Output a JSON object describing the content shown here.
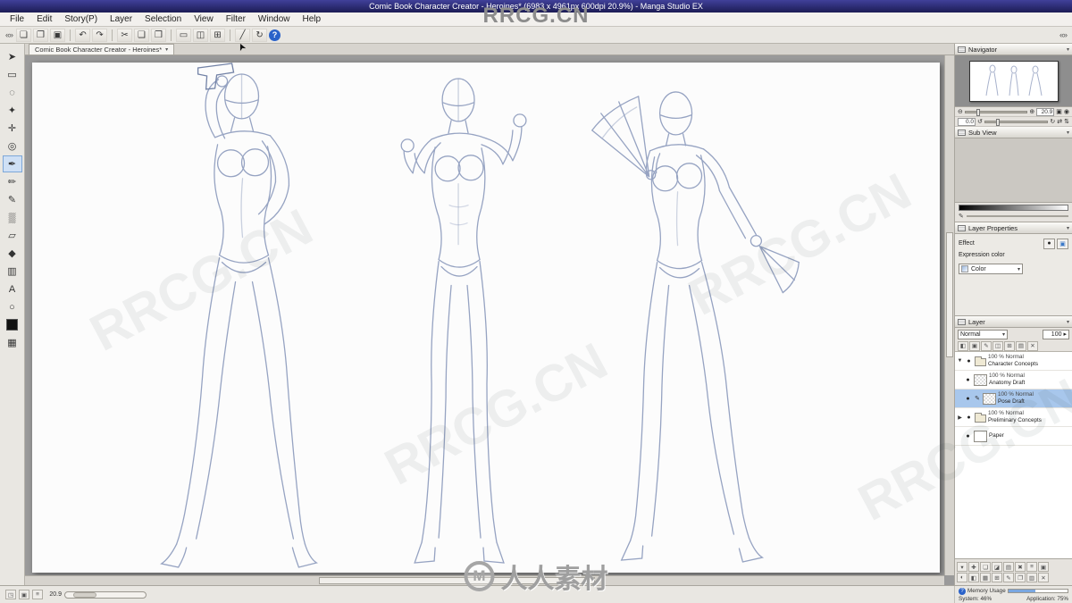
{
  "titlebar": {
    "title": "Comic Book Character Creator - Heroines* (6983 x 4961px 600dpi 20.9%) - Manga Studio EX"
  },
  "menubar": {
    "items": [
      "File",
      "Edit",
      "Story(P)",
      "Layer",
      "Selection",
      "View",
      "Filter",
      "Window",
      "Help"
    ]
  },
  "chrome": {
    "left": "«»",
    "right": "«»",
    "cursor": "➤"
  },
  "toolbar": {
    "icons": [
      "❏",
      "❐",
      "▣",
      "↶",
      "↷",
      "✂",
      "❑",
      "❒",
      "▭",
      "◫",
      "⊞",
      "╱",
      "↻"
    ],
    "help_glyph": "?"
  },
  "tabbar": {
    "active_tab": "Comic Book Character Creator - Heroines*",
    "dropdown_glyph": "▾"
  },
  "panels": {
    "menu_glyph": "▾",
    "close_glyph": "✕"
  },
  "tools": {
    "items": [
      {
        "name": "select-tool",
        "glyph": "➤"
      },
      {
        "name": "marquee-tool",
        "glyph": "▭"
      },
      {
        "name": "lasso-tool",
        "glyph": "◌"
      },
      {
        "name": "magic-wand-tool",
        "glyph": "✦"
      },
      {
        "name": "move-tool",
        "glyph": "✛"
      },
      {
        "name": "zoom-tool",
        "glyph": "◎"
      },
      {
        "name": "pen-tool",
        "glyph": "✒"
      },
      {
        "name": "pencil-tool",
        "glyph": "✏"
      },
      {
        "name": "brush-tool",
        "glyph": "✎"
      },
      {
        "name": "airbrush-tool",
        "glyph": "▒"
      },
      {
        "name": "eraser-tool",
        "glyph": "▱"
      },
      {
        "name": "fill-tool",
        "glyph": "◆"
      },
      {
        "name": "gradient-tool",
        "glyph": "▥"
      },
      {
        "name": "text-tool",
        "glyph": "A"
      },
      {
        "name": "shape-tool",
        "glyph": "○"
      },
      {
        "name": "color-swatch",
        "glyph": ""
      },
      {
        "name": "pattern-swatch",
        "glyph": "▦"
      }
    ]
  },
  "navigator": {
    "title": "Navigator",
    "zoom_out": "⊖",
    "zoom_in": "⊕",
    "zoom_value": "20.9",
    "fit": "▣",
    "reset": "◉",
    "rotate_left": "↺",
    "rotate_right": "↻",
    "rotate_value": "0.0",
    "flip_h": "⇄",
    "flip_v": "⇅"
  },
  "subview": {
    "title": "Sub View"
  },
  "strip": {
    "pen_glyph": "✎"
  },
  "layer_properties": {
    "title": "Layer Properties",
    "effect_label": "Effect",
    "border_effect_glyph": "●",
    "tone_effect_glyph": "▣",
    "expression_label": "Expression color",
    "expression_value": "Color",
    "dropdown_glyph": "▾"
  },
  "layer_panel": {
    "title": "Layer",
    "blend_mode": "Normal",
    "dropdown_glyph": "▾",
    "opacity": "100",
    "spin_glyph": "▸",
    "eye_glyph": "●",
    "edit_glyph": "✎",
    "expand_open": "▼",
    "expand_closed": "▶",
    "lock_icons": [
      "◧",
      "▣",
      "✎",
      "◫",
      "⊞",
      "▤",
      "✕"
    ],
    "layers": [
      {
        "info": "100 %  Normal",
        "name": "Character Concepts"
      },
      {
        "info": "100 %  Normal",
        "name": "Anatomy Draft"
      },
      {
        "info": "100 %  Normal",
        "name": "Pose Draft"
      },
      {
        "info": "100 %  Normal",
        "name": "Preliminary Concepts"
      },
      {
        "info": "",
        "name": "Paper"
      }
    ],
    "toolbar_row1": [
      "▾",
      "✚",
      "❏",
      "◪",
      "▤",
      "✖",
      "≡",
      "▣"
    ],
    "toolbar_row2": [
      "◐",
      "◧",
      "▦",
      "⊞",
      "✎",
      "❐",
      "▥",
      "✕"
    ]
  },
  "statusbar": {
    "icons": [
      "◳",
      "▣",
      "≡"
    ],
    "zoom_value": "20.9",
    "help_glyph": "?",
    "memory_label": "Memory Usage",
    "system": "System: 46%",
    "application": "Application: 75%"
  },
  "watermarks": {
    "top": "RRCG.CN",
    "diagonal": "RRCG.CN",
    "bottom_logo": "M",
    "bottom_text": "人人素材"
  }
}
